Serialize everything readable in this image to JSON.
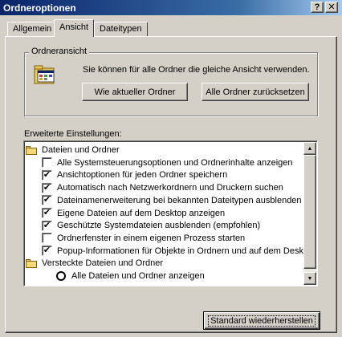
{
  "window": {
    "title": "Ordneroptionen",
    "help_button": "?",
    "close_button": "✕"
  },
  "tabs": [
    {
      "label": "Allgemein",
      "active": false
    },
    {
      "label": "Ansicht",
      "active": true
    },
    {
      "label": "Dateitypen",
      "active": false
    }
  ],
  "folder_view": {
    "title": "Ordneransicht",
    "description": "Sie können für alle Ordner die gleiche Ansicht verwenden.",
    "button_like_current": "Wie aktueller Ordner",
    "button_reset_all": "Alle Ordner zurücksetzen"
  },
  "advanced": {
    "label": "Erweiterte Einstellungen:",
    "items": [
      {
        "type": "folder",
        "label": "Dateien und Ordner"
      },
      {
        "type": "checkbox",
        "checked": false,
        "label": "Alle Systemsteuerungsoptionen und Ordnerinhalte anzeigen"
      },
      {
        "type": "checkbox",
        "checked": true,
        "label": "Ansichtoptionen für jeden Ordner speichern"
      },
      {
        "type": "checkbox",
        "checked": true,
        "label": "Automatisch nach Netzwerkordnern und Druckern suchen"
      },
      {
        "type": "checkbox",
        "checked": true,
        "label": "Dateinamenerweiterung bei bekannten Dateitypen ausblenden"
      },
      {
        "type": "checkbox",
        "checked": true,
        "label": "Eigene Dateien auf dem Desktop anzeigen"
      },
      {
        "type": "checkbox",
        "checked": true,
        "label": "Geschützte Systemdateien ausblenden (empfohlen)"
      },
      {
        "type": "checkbox",
        "checked": false,
        "label": "Ordnerfenster in einem eigenen Prozess starten"
      },
      {
        "type": "checkbox",
        "checked": true,
        "label": "Popup-Informationen für Objekte in Ordnern und auf dem Desktop"
      },
      {
        "type": "folder",
        "label": "Versteckte Dateien und Ordner"
      },
      {
        "type": "radio",
        "checked": true,
        "label": "Alle Dateien und Ordner anzeigen"
      }
    ],
    "check_glyph": "✔"
  },
  "restore_button": "Standard wiederherstellen"
}
